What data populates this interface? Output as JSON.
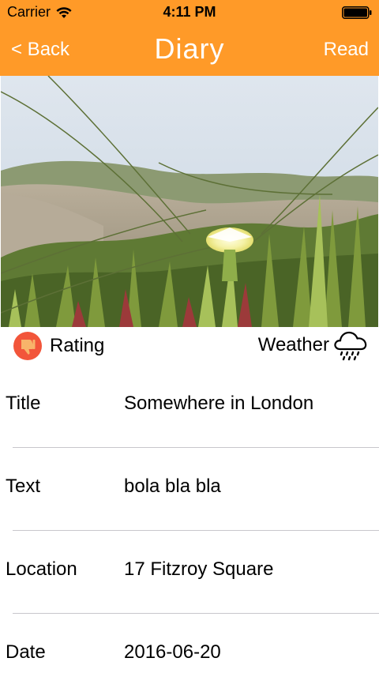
{
  "status_bar": {
    "carrier": "Carrier",
    "time": "4:11 PM",
    "wifi_icon": "wifi-icon",
    "battery_icon": "battery-full-icon"
  },
  "nav": {
    "back_label": "< Back",
    "title": "Diary",
    "read_label": "Read",
    "background_color": "#FF9A28",
    "text_color": "#FFFFFF"
  },
  "photo": {
    "subject": "photo-icon"
  },
  "meta": {
    "rating_label": "Rating",
    "rating_icon": "thumbs-down-icon",
    "rating_icon_color": "#F2553A",
    "weather_label": "Weather",
    "weather_icon": "rain-cloud-icon"
  },
  "details": [
    {
      "label": "Title",
      "value": "Somewhere in London"
    },
    {
      "label": "Text",
      "value": "bola bla bla"
    },
    {
      "label": "Location",
      "value": "17 Fitzroy Square"
    },
    {
      "label": "Date",
      "value": "2016-06-20"
    }
  ]
}
